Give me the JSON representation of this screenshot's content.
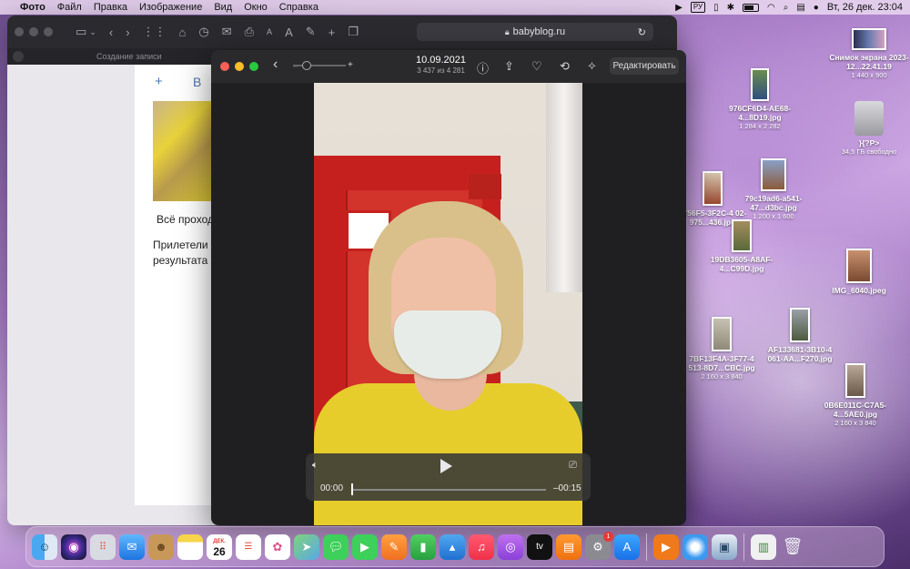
{
  "menubar": {
    "app_name": "Фото",
    "items": [
      "Файл",
      "Правка",
      "Изображение",
      "Вид",
      "Окно",
      "Справка"
    ],
    "lang": "РУ",
    "datetime": "Вт, 26 дек.  23:04"
  },
  "safari": {
    "url": "babyblog.ru",
    "tab_title": "Создание записи",
    "page": {
      "toolbar_plus": "+",
      "toolbar_b": "В",
      "text1": "Всё проход",
      "text2_line1": "Прилетели м",
      "text2_line2": "результата"
    }
  },
  "photos": {
    "date": "10.09.2021",
    "counter": "3 437 из 4 281",
    "edit_label": "Редактировать",
    "zoom_minus": "–",
    "zoom_plus": "+",
    "player": {
      "current_time": "00:00",
      "remaining_time": "–00:15",
      "progress": 0
    }
  },
  "desktop_icons": [
    {
      "name": "Снимок экрана 2023-12...22.41.19",
      "dims": "1 440 x 900"
    },
    {
      "name": "976CF6D4-AE68-4...8D19.jpg",
      "dims": "1 284 x 2 282"
    },
    {
      "name": "}{?P>",
      "dims": "34,5 ГБ свободно"
    },
    {
      "name": "79c19ad6-a541-47...d3bc.jpg",
      "dims": "1 200 x 1 600"
    },
    {
      "name": "0756F5-3F2C-4 02-975...436.jpg",
      "dims": ""
    },
    {
      "name": "19DB3605-A8AF-4...C99D.jpg",
      "dims": ""
    },
    {
      "name": "IMG_6040.jpeg",
      "dims": ""
    },
    {
      "name": "AF133681-3B10-4 061-AA...F270.jpg",
      "dims": ""
    },
    {
      "name": "7BF13F4A-3F77-4 513-8D7...CBC.jpg",
      "dims": "2 160 x 3 840"
    },
    {
      "name": "0B6E011C-C7A5-4...5AE0.jpg",
      "dims": "2 160 x 3 840"
    }
  ],
  "dock": {
    "calendar_month": "ДЕК.",
    "calendar_day": "26",
    "settings_badge": "1",
    "tv_label": "tv"
  }
}
